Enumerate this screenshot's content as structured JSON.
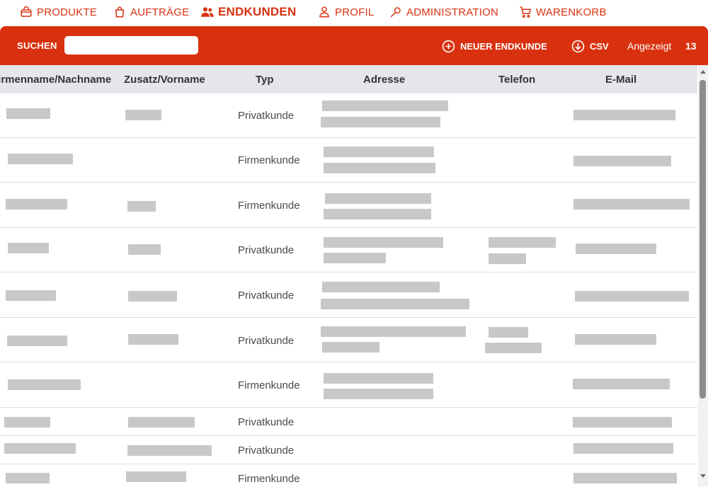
{
  "nav": {
    "items": [
      {
        "label": "PRODUKTE",
        "icon": "bag-icon",
        "active": false
      },
      {
        "label": "AUFTRÄGE",
        "icon": "shopping-bag-icon",
        "active": false
      },
      {
        "label": "ENDKUNDEN",
        "icon": "users-icon",
        "active": true
      },
      {
        "label": "PROFIL",
        "icon": "user-icon",
        "active": false
      },
      {
        "label": "ADMINISTRATION",
        "icon": "wrench-icon",
        "active": false
      },
      {
        "label": "WARENKORB",
        "icon": "cart-icon",
        "active": false
      }
    ]
  },
  "toolbar": {
    "search_label": "SUCHEN",
    "search_value": "",
    "new_customer_label": "NEUER ENDKUNDE",
    "csv_label": "CSV",
    "shown_label": "Angezeigt",
    "shown_count": "13"
  },
  "table": {
    "columns": [
      "Firmenname/Nachname",
      "Zusatz/Vorname",
      "Typ",
      "Adresse",
      "Telefon",
      "E-Mail"
    ],
    "rows": [
      {
        "typ": "Privatkunde"
      },
      {
        "typ": "Firmenkunde"
      },
      {
        "typ": "Firmenkunde"
      },
      {
        "typ": "Privatkunde"
      },
      {
        "typ": "Privatkunde"
      },
      {
        "typ": "Privatkunde"
      },
      {
        "typ": "Firmenkunde"
      },
      {
        "typ": "Privatkunde"
      },
      {
        "typ": "Privatkunde"
      },
      {
        "typ": "Firmenkunde"
      }
    ]
  },
  "colors": {
    "accent": "#d9310f",
    "header_bg": "#e5e6ea",
    "redacted": "#c8c8c8"
  }
}
